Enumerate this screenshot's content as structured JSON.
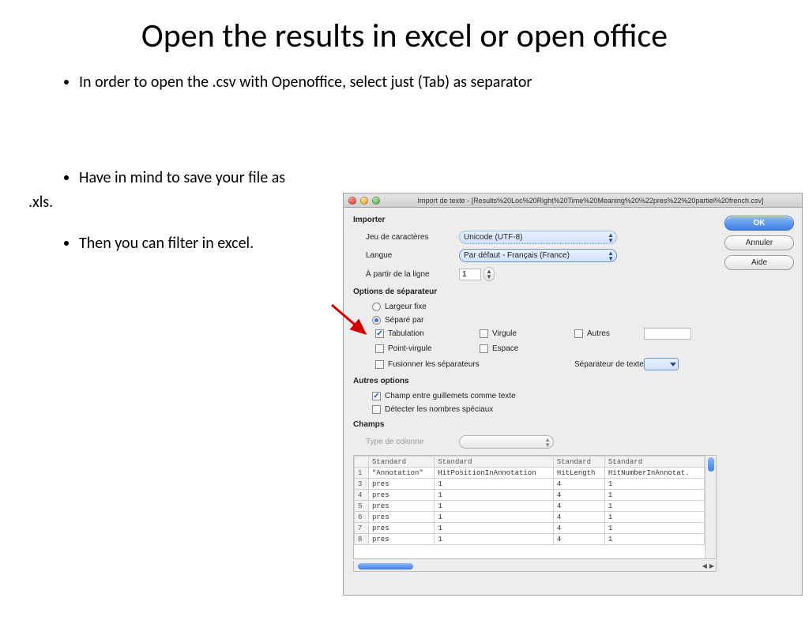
{
  "slide": {
    "title": "Open the results in excel or open office",
    "bullet1": "In order to open the .csv with Openoffice, select just (Tab) as separator",
    "bullet2": "Have in mind to save your file as",
    "xls": ".xls.",
    "bullet3": "Then you can filter in excel."
  },
  "dialog": {
    "title": "Import de texte - [Results%20Loc%20Right%20Time%20Meaning%20%22pres%22%20partiel%20french.csv]",
    "sec_import": "Importer",
    "charset_lbl": "Jeu de caractères",
    "charset_val": "Unicode (UTF-8)",
    "lang_lbl": "Langue",
    "lang_val": "Par défaut - Français (France)",
    "fromline_lbl": "À partir de la ligne",
    "fromline_val": "1",
    "sec_sep": "Options de séparateur",
    "radio_fixed": "Largeur fixe",
    "radio_sep": "Séparé par",
    "chk_tab": "Tabulation",
    "chk_comma": "Virgule",
    "chk_other": "Autres",
    "chk_semi": "Point-virgule",
    "chk_space": "Espace",
    "chk_merge": "Fusionner les séparateurs",
    "txt_sep_lbl": "Séparateur de texte",
    "sec_other": "Autres options",
    "chk_quoted": "Champ entre guillemets comme texte",
    "chk_detect": "Détecter les nombres spéciaux",
    "sec_fields": "Champs",
    "coltype_lbl": "Type de colonne",
    "btn_ok": "OK",
    "btn_cancel": "Annuler",
    "btn_help": "Aide",
    "headers": [
      "Standard",
      "Standard",
      "Standard",
      "Standard"
    ],
    "hdr_row": [
      "\"Annotation\"",
      "HitPositionInAnnotation",
      "HitLength",
      "HitNumberInAnnotat."
    ],
    "rows": [
      [
        "pres",
        "1",
        "4",
        "1"
      ],
      [
        "pres",
        "1",
        "4",
        "1"
      ],
      [
        "pres",
        "1",
        "4",
        "1"
      ],
      [
        "pres",
        "1",
        "4",
        "1"
      ],
      [
        "pres",
        "1",
        "4",
        "1"
      ],
      [
        "pres",
        "1",
        "4",
        "1"
      ]
    ]
  }
}
